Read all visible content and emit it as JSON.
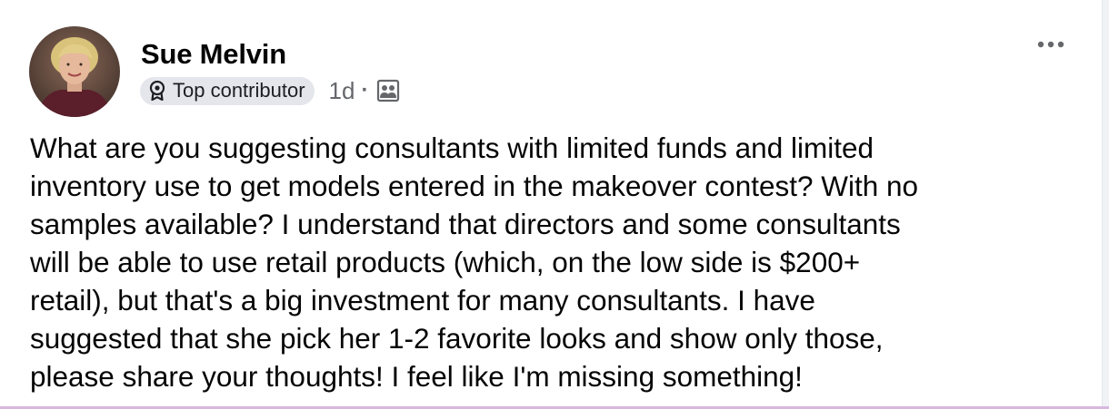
{
  "post": {
    "author": {
      "name": "Sue Melvin",
      "avatar_icon": "profile-photo"
    },
    "badge": {
      "icon": "award-ribbon-icon",
      "label": "Top contributor"
    },
    "timestamp": "1d",
    "separator": "·",
    "audience_icon": "group-members-icon",
    "more_icon": "more-options-icon",
    "text": "What are you suggesting consultants with limited funds and limited\ninventory use to get models entered in the makeover contest? With no\nsamples available? I understand that directors and some consultants\nwill be able to use retail products (which, on the low side is $200+\nretail), but that's a big investment for many consultants. I have\nsuggested that she pick her 1-2 favorite looks and show only those,\nplease share your thoughts! I feel like I'm missing something!"
  },
  "colors": {
    "text_primary": "#050505",
    "text_secondary": "#65676b",
    "badge_background": "#e4e6eb",
    "bottom_border": "#d8b8df"
  }
}
